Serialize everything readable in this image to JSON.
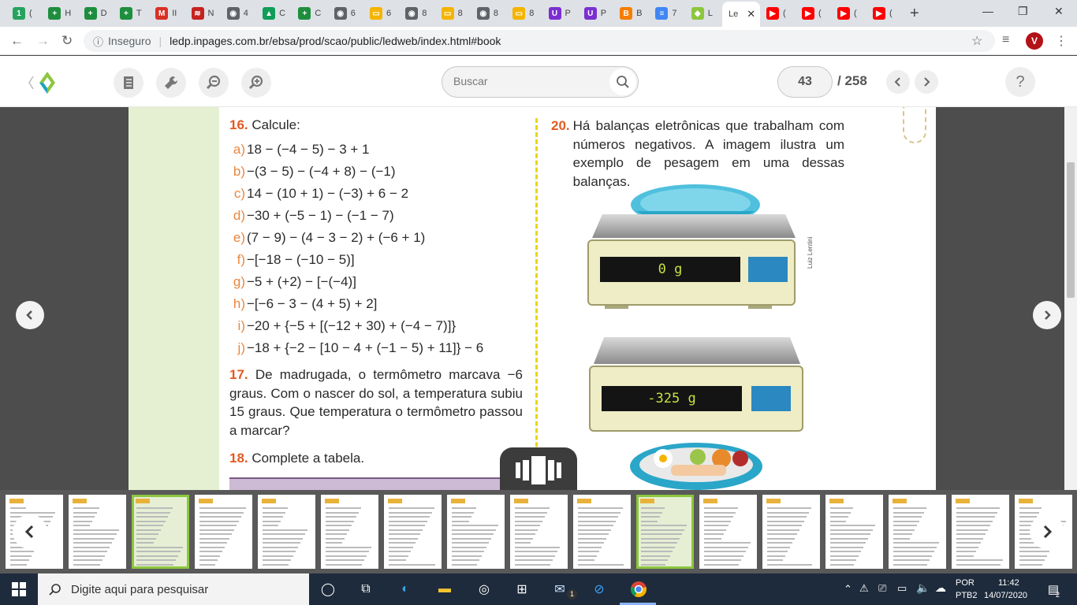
{
  "browser": {
    "tabs": [
      {
        "short": "(",
        "fav": "1",
        "color": "#27a35f"
      },
      {
        "short": "H",
        "fav": "+",
        "color": "#1e8e3e"
      },
      {
        "short": "D",
        "fav": "+",
        "color": "#1e8e3e"
      },
      {
        "short": "T",
        "fav": "+",
        "color": "#1e8e3e"
      },
      {
        "short": "II",
        "fav": "M",
        "color": "#d93025"
      },
      {
        "short": "N",
        "fav": "≋",
        "color": "#c5221f"
      },
      {
        "short": "4",
        "fav": "◉",
        "color": "#5f6368"
      },
      {
        "short": "C",
        "fav": "▲",
        "color": "#0f9d58"
      },
      {
        "short": "C",
        "fav": "+",
        "color": "#1e8e3e"
      },
      {
        "short": "6",
        "fav": "◉",
        "color": "#5f6368"
      },
      {
        "short": "6",
        "fav": "▭",
        "color": "#f4b400"
      },
      {
        "short": "8",
        "fav": "◉",
        "color": "#5f6368"
      },
      {
        "short": "8",
        "fav": "▭",
        "color": "#f4b400"
      },
      {
        "short": "8",
        "fav": "◉",
        "color": "#5f6368"
      },
      {
        "short": "8",
        "fav": "▭",
        "color": "#f4b400"
      },
      {
        "short": "P",
        "fav": "U",
        "color": "#7b2fd1"
      },
      {
        "short": "P",
        "fav": "U",
        "color": "#7b2fd1"
      },
      {
        "short": "B",
        "fav": "B",
        "color": "#f57d00"
      },
      {
        "short": "7",
        "fav": "≡",
        "color": "#4285f4"
      },
      {
        "short": "L",
        "fav": "◆",
        "color": "#8cc63f"
      }
    ],
    "active_tab": {
      "label": "Le",
      "close": "✕"
    },
    "tabs_after": [
      {
        "short": "(",
        "fav": "▶",
        "color": "#ff0000"
      },
      {
        "short": "(",
        "fav": "▶",
        "color": "#ff0000"
      },
      {
        "short": "(",
        "fav": "▶",
        "color": "#ff0000"
      },
      {
        "short": "(",
        "fav": "▶",
        "color": "#ff0000"
      }
    ],
    "new_tab": "+",
    "insecure_label": "Inseguro",
    "url": "ledp.inpages.com.br/ebsa/prod/scao/public/ledweb/index.html#book",
    "profile_initial": "V"
  },
  "reader": {
    "search_placeholder": "Buscar",
    "current_page": "43",
    "total_pages": "/ 258",
    "help": "?"
  },
  "book": {
    "q16": {
      "num": "16.",
      "title": "Calcule:",
      "items": [
        {
          "letter": "a)",
          "expr": "18 − (−4 −  5) − 3 + 1"
        },
        {
          "letter": "b)",
          "expr": "−(3 − 5) − (−4 + 8) − (−1)"
        },
        {
          "letter": "c)",
          "expr": "14 − (10 + 1) − (−3) + 6 − 2"
        },
        {
          "letter": "d)",
          "expr": "−30 + (−5 − 1) − (−1 − 7)"
        },
        {
          "letter": "e)",
          "expr": "(7 − 9) − (4 − 3 − 2) + (−6 + 1)"
        },
        {
          "letter": "f)",
          "expr": "−[−18 − (−10 − 5)]"
        },
        {
          "letter": "g)",
          "expr": "−5 + (+2) − [−(−4)]"
        },
        {
          "letter": "h)",
          "expr": "−[−6 − 3 − (4 + 5) + 2]"
        },
        {
          "letter": "i)",
          "expr": "−20 + {−5 + [(−12 + 30) + (−4 − 7)]}"
        },
        {
          "letter": "j)",
          "expr": "−18 + {−2 − [10 − 4 + (−1 − 5) + 11]} − 6"
        }
      ]
    },
    "q17": {
      "num": "17.",
      "text": "De madrugada, o termômetro marcava −6 graus. Com o nascer do sol, a temperatura subiu 15 graus. Que temperatura o termômetro passou a marcar?"
    },
    "q18": {
      "num": "18.",
      "text": "Complete a tabela."
    },
    "q20": {
      "num": "20.",
      "text": "Há balanças eletrônicas que trabalham com números negativos. A imagem ilustra um exemplo de pesagem em uma dessas balanças."
    },
    "credit": "Luiz Lentini",
    "scale1_display": "0 g",
    "scale2_display": "-325 g"
  },
  "taskbar": {
    "search_placeholder": "Digite aqui para pesquisar",
    "lang": "POR",
    "layout": "PTB2",
    "time": "11:42",
    "date": "14/07/2020",
    "notifications": "2",
    "mail_badge": "1"
  }
}
